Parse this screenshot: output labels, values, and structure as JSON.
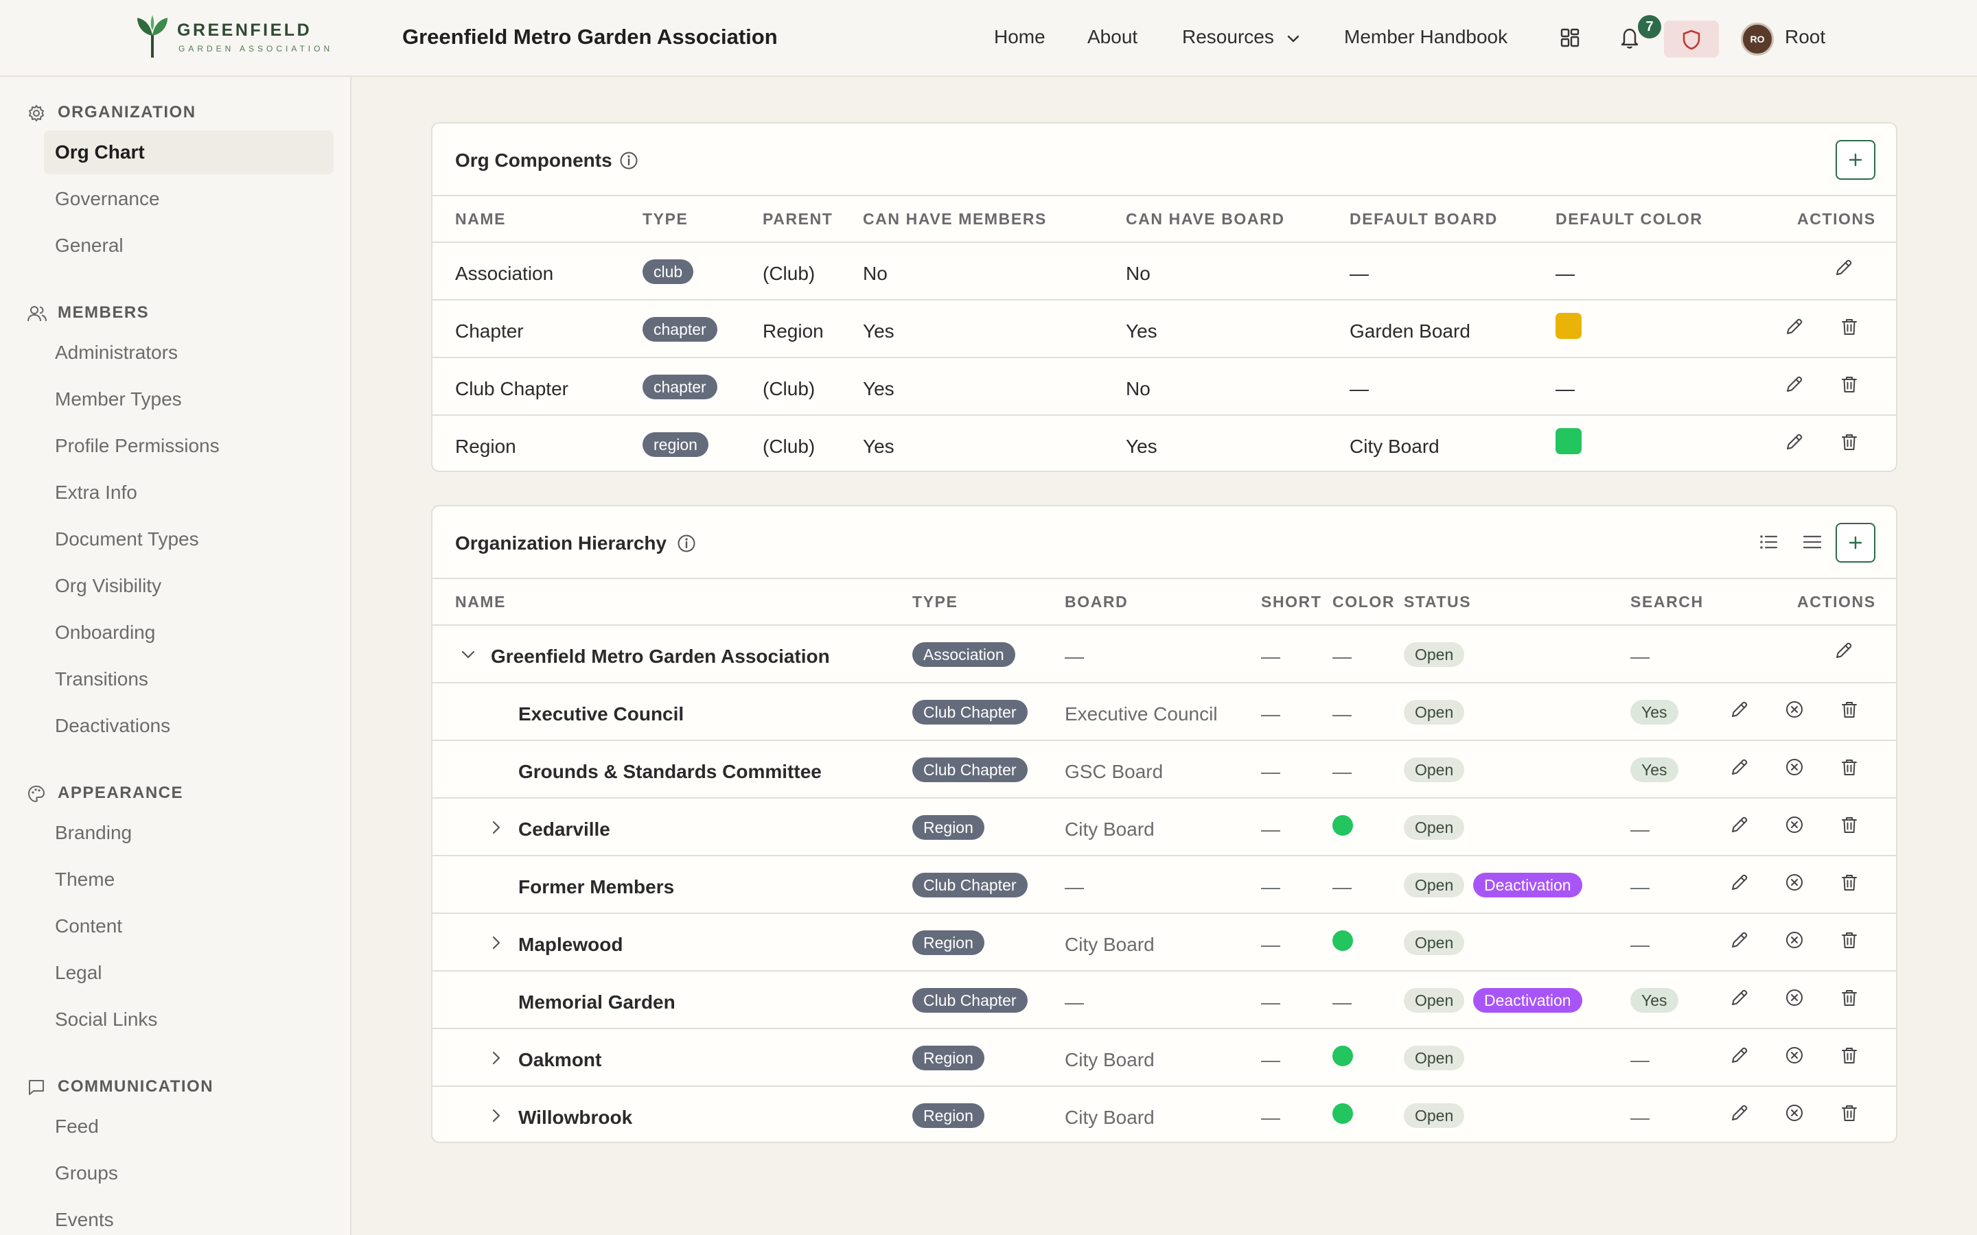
{
  "brand": {
    "name": "GREENFIELD",
    "tagline": "GARDEN ASSOCIATION",
    "app_title": "Greenfield Metro Garden Association"
  },
  "nav": {
    "items": [
      "Home",
      "About",
      "Resources",
      "Member Handbook"
    ],
    "notification_count": "7",
    "user_initials": "RO",
    "user_name": "Root"
  },
  "sidebar": {
    "sections": [
      {
        "title": "ORGANIZATION",
        "icon": "gear-icon",
        "items": [
          "Org Chart",
          "Governance",
          "General"
        ]
      },
      {
        "title": "MEMBERS",
        "icon": "users-icon",
        "items": [
          "Administrators",
          "Member Types",
          "Profile Permissions",
          "Extra Info",
          "Document Types",
          "Org Visibility",
          "Onboarding",
          "Transitions",
          "Deactivations"
        ]
      },
      {
        "title": "APPEARANCE",
        "icon": "palette-icon",
        "items": [
          "Branding",
          "Theme",
          "Content",
          "Legal",
          "Social Links"
        ]
      },
      {
        "title": "COMMUNICATION",
        "icon": "message-icon",
        "items": [
          "Feed",
          "Groups",
          "Events"
        ]
      }
    ],
    "active_item": "Org Chart"
  },
  "org_components": {
    "title": "Org Components",
    "columns": [
      "NAME",
      "TYPE",
      "PARENT",
      "CAN HAVE MEMBERS",
      "CAN HAVE BOARD",
      "DEFAULT BOARD",
      "DEFAULT COLOR",
      "ACTIONS"
    ],
    "rows": [
      {
        "name": "Association",
        "type": "club",
        "parent": "(Club)",
        "can_have_members": "No",
        "can_have_board": "No",
        "default_board": "—",
        "default_color": "—",
        "color_hex": "",
        "deletable": false
      },
      {
        "name": "Chapter",
        "type": "chapter",
        "parent": "Region",
        "can_have_members": "Yes",
        "can_have_board": "Yes",
        "default_board": "Garden Board",
        "default_color": "",
        "color_hex": "#eab308",
        "deletable": true
      },
      {
        "name": "Club Chapter",
        "type": "chapter",
        "parent": "(Club)",
        "can_have_members": "Yes",
        "can_have_board": "No",
        "default_board": "—",
        "default_color": "—",
        "color_hex": "",
        "deletable": true
      },
      {
        "name": "Region",
        "type": "region",
        "parent": "(Club)",
        "can_have_members": "Yes",
        "can_have_board": "Yes",
        "default_board": "City Board",
        "default_color": "",
        "color_hex": "#22c55e",
        "deletable": true
      }
    ]
  },
  "hierarchy": {
    "title": "Organization Hierarchy",
    "columns": [
      "NAME",
      "TYPE",
      "BOARD",
      "SHORT",
      "COLOR",
      "STATUS",
      "SEARCH",
      "ACTIONS"
    ],
    "rows": [
      {
        "name": "Greenfield Metro Garden Association",
        "type": "Association",
        "board": "—",
        "short": "—",
        "color": "—",
        "color_hex": "",
        "status": "Open",
        "deactivation": "",
        "search": "—",
        "expander": "expanded",
        "level": 0,
        "root": true
      },
      {
        "name": "Executive Council",
        "type": "Club Chapter",
        "board": "Executive Council",
        "short": "—",
        "color": "—",
        "color_hex": "",
        "status": "Open",
        "deactivation": "",
        "search": "Yes",
        "expander": "none",
        "level": 1,
        "root": false
      },
      {
        "name": "Grounds & Standards Committee",
        "type": "Club Chapter",
        "board": "GSC Board",
        "short": "—",
        "color": "—",
        "color_hex": "",
        "status": "Open",
        "deactivation": "",
        "search": "Yes",
        "expander": "none",
        "level": 1,
        "root": false
      },
      {
        "name": "Cedarville",
        "type": "Region",
        "board": "City Board",
        "short": "—",
        "color": "",
        "color_hex": "#22c55e",
        "status": "Open",
        "deactivation": "",
        "search": "—",
        "expander": "collapsed",
        "level": 1,
        "root": false
      },
      {
        "name": "Former Members",
        "type": "Club Chapter",
        "board": "—",
        "short": "—",
        "color": "—",
        "color_hex": "",
        "status": "Open",
        "deactivation": "Deactivation",
        "search": "—",
        "expander": "none",
        "level": 1,
        "root": false
      },
      {
        "name": "Maplewood",
        "type": "Region",
        "board": "City Board",
        "short": "—",
        "color": "",
        "color_hex": "#22c55e",
        "status": "Open",
        "deactivation": "",
        "search": "—",
        "expander": "collapsed",
        "level": 1,
        "root": false
      },
      {
        "name": "Memorial Garden",
        "type": "Club Chapter",
        "board": "—",
        "short": "—",
        "color": "—",
        "color_hex": "",
        "status": "Open",
        "deactivation": "Deactivation",
        "search": "Yes",
        "expander": "none",
        "level": 1,
        "root": false
      },
      {
        "name": "Oakmont",
        "type": "Region",
        "board": "City Board",
        "short": "—",
        "color": "",
        "color_hex": "#22c55e",
        "status": "Open",
        "deactivation": "",
        "search": "—",
        "expander": "collapsed",
        "level": 1,
        "root": false
      },
      {
        "name": "Willowbrook",
        "type": "Region",
        "board": "City Board",
        "short": "—",
        "color": "",
        "color_hex": "#22c55e",
        "status": "Open",
        "deactivation": "",
        "search": "—",
        "expander": "collapsed",
        "level": 1,
        "root": false
      }
    ]
  },
  "colors": {
    "accent": "#2e6b4a",
    "type_pill": "#646b7b",
    "deactivation": "#a855f7",
    "status_open_bg": "#e4e8df"
  }
}
